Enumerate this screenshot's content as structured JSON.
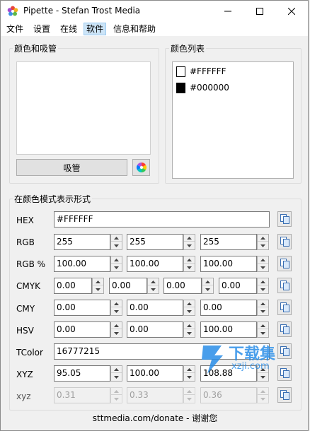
{
  "window": {
    "title": "Pipette - Stefan Trost Media"
  },
  "menu": [
    "文件",
    "设置",
    "在线",
    "软件",
    "信息和帮助"
  ],
  "pick_group": {
    "label": "颜色和吸管",
    "eyedropper_label": "吸管"
  },
  "list_group": {
    "label": "颜色列表",
    "items": [
      {
        "text": "#FFFFFF",
        "color": "#FFFFFF"
      },
      {
        "text": "#000000",
        "color": "#000000"
      }
    ]
  },
  "modes_group": {
    "label": "在颜色模式表示形式"
  },
  "rows": {
    "hex": {
      "label": "HEX",
      "value": "#FFFFFF"
    },
    "rgb": {
      "label": "RGB",
      "values": [
        "255",
        "255",
        "255"
      ]
    },
    "rgb_pct": {
      "label": "RGB %",
      "values": [
        "100.00",
        "100.00",
        "100.00"
      ]
    },
    "cmyk": {
      "label": "CMYK",
      "values": [
        "0.00",
        "0.00",
        "0.00",
        "0.00"
      ]
    },
    "cmy": {
      "label": "CMY",
      "values": [
        "0.00",
        "0.00",
        "0.00"
      ]
    },
    "hsv": {
      "label": "HSV",
      "values": [
        "0.00",
        "0.00",
        "100.00"
      ]
    },
    "tcolor": {
      "label": "TColor",
      "value": "16777215"
    },
    "xyz": {
      "label": "XYZ",
      "values": [
        "95.05",
        "100.00",
        "108.88"
      ]
    },
    "xyz_small": {
      "label": "xyz",
      "values": [
        "0.31",
        "0.33",
        "0.36"
      ]
    }
  },
  "footer": "sttmedia.com/donate - 谢谢您",
  "watermark": {
    "text": "下载集",
    "url": "xzji.com"
  }
}
